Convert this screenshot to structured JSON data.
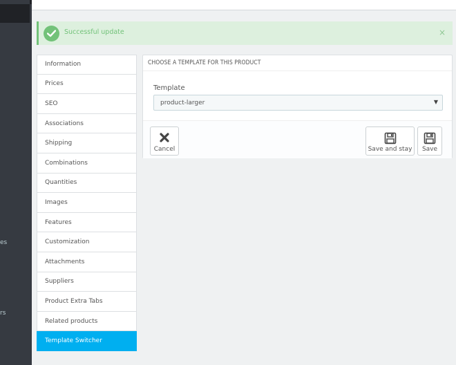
{
  "sidebar": {
    "cut_text_1": "es",
    "cut_text_2": "rs"
  },
  "alert": {
    "message": "Successful update",
    "close_symbol": "×",
    "color": "#72c279"
  },
  "tabs": [
    {
      "label": "Information"
    },
    {
      "label": "Prices"
    },
    {
      "label": "SEO"
    },
    {
      "label": "Associations"
    },
    {
      "label": "Shipping"
    },
    {
      "label": "Combinations"
    },
    {
      "label": "Quantities"
    },
    {
      "label": "Images"
    },
    {
      "label": "Features"
    },
    {
      "label": "Customization"
    },
    {
      "label": "Attachments"
    },
    {
      "label": "Suppliers"
    },
    {
      "label": "Product Extra Tabs"
    },
    {
      "label": "Related products"
    },
    {
      "label": "Template Switcher"
    }
  ],
  "active_tab": "Template Switcher",
  "accent_color": "#00aff0",
  "panel": {
    "title": "CHOOSE A TEMPLATE FOR THIS PRODUCT",
    "field_label": "Template",
    "select_value": "product-larger",
    "caret": "▼"
  },
  "footer": {
    "cancel_label": "Cancel",
    "save_stay_label": "Save and stay",
    "save_label": "Save",
    "cancel_icon": "close-icon",
    "save_icon": "floppy-disk-icon"
  }
}
